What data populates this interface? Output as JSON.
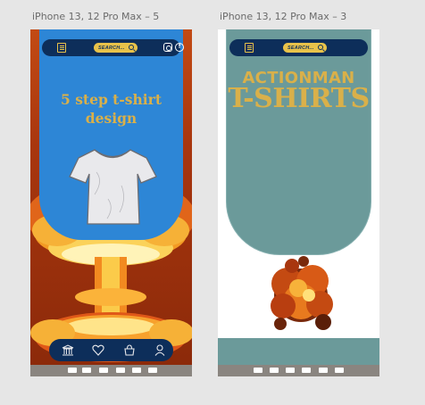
{
  "frames": [
    {
      "label": "iPhone 13, 12 Pro Max – 5",
      "nav": {
        "search_placeholder": "SEARCH..."
      },
      "title": "5 step t-shirt design"
    },
    {
      "label": "iPhone 13, 12 Pro Max – 3",
      "nav": {
        "search_placeholder": "SEARCH..."
      },
      "title_line1": "ACTIONMAN",
      "title_line2": "T-SHIRTS"
    }
  ],
  "icons": {
    "menu": "menu-icon",
    "search": "search-icon",
    "instagram": "instagram-icon",
    "facebook": "facebook-icon",
    "home": "bank-icon",
    "favorite": "heart-icon",
    "cart": "bag-icon",
    "profile": "user-icon"
  },
  "colors": {
    "nav": "#0d2e5a",
    "accent": "#e8c24a",
    "title": "#d9b04a",
    "blob_blue": "#2d86d6",
    "blob_teal": "#6b9a9a"
  }
}
